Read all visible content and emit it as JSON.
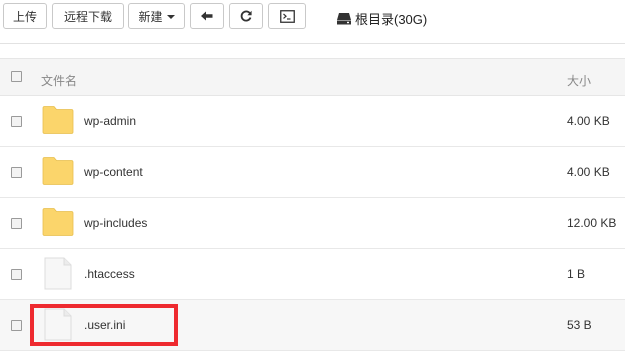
{
  "toolbar": {
    "upload_label": "上传",
    "remote_download_label": "远程下载",
    "new_label": "新建",
    "root_label": "根目录(30G)"
  },
  "table": {
    "header": {
      "name": "文件名",
      "size": "大小"
    },
    "rows": [
      {
        "name": "wp-admin",
        "size": "4.00 KB",
        "type": "folder"
      },
      {
        "name": "wp-content",
        "size": "4.00 KB",
        "type": "folder"
      },
      {
        "name": "wp-includes",
        "size": "12.00 KB",
        "type": "folder"
      },
      {
        "name": ".htaccess",
        "size": "1 B",
        "type": "file"
      },
      {
        "name": ".user.ini",
        "size": "53 B",
        "type": "file"
      }
    ]
  },
  "colors": {
    "folder": "#fbd56b",
    "highlight": "#ee2a2f"
  }
}
